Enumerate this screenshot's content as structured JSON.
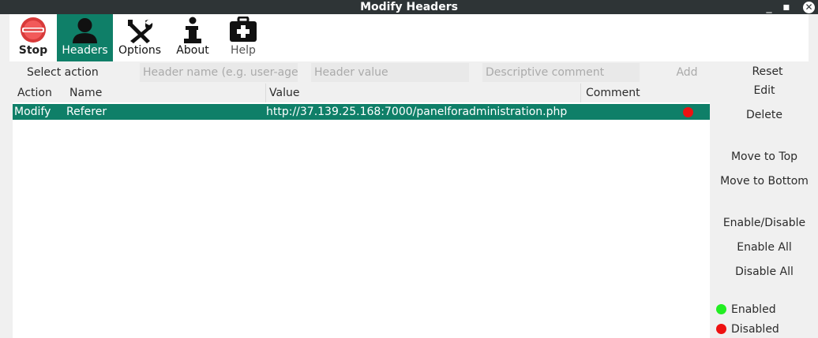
{
  "window": {
    "title": "Modify Headers",
    "minimize": "_",
    "maximize": "▪",
    "close": "✕"
  },
  "toolbar": {
    "stop": "Stop",
    "headers": "Headers",
    "options": "Options",
    "about": "About",
    "help": "Help"
  },
  "form": {
    "select_action": "Select action",
    "header_name_placeholder": "Header name (e.g. user-agent)",
    "header_value_placeholder": "Header value",
    "comment_placeholder": "Descriptive comment",
    "add_label": "Add"
  },
  "table": {
    "columns": [
      "Action",
      "Name",
      "Value",
      "Comment"
    ],
    "rows": [
      {
        "action": "Modify",
        "name": "Referer",
        "value": "http://37.139.25.168:7000/panelforadministration.php",
        "comment": "",
        "status": "disabled"
      }
    ]
  },
  "side": {
    "reset": "Reset",
    "edit": "Edit",
    "delete": "Delete",
    "move_top": "Move to Top",
    "move_bottom": "Move to Bottom",
    "enable_disable": "Enable/Disable",
    "enable_all": "Enable All",
    "disable_all": "Disable All"
  },
  "legend": {
    "enabled": "Enabled",
    "disabled": "Disabled"
  },
  "colors": {
    "accent": "#0f7f68",
    "enabled": "#22ee22",
    "disabled": "#ee1111",
    "titlebar": "#2e3436"
  },
  "icons": {
    "stop": "stop-icon",
    "headers": "person-icon",
    "options": "tools-icon",
    "about": "info-icon",
    "help": "first-aid-icon"
  }
}
